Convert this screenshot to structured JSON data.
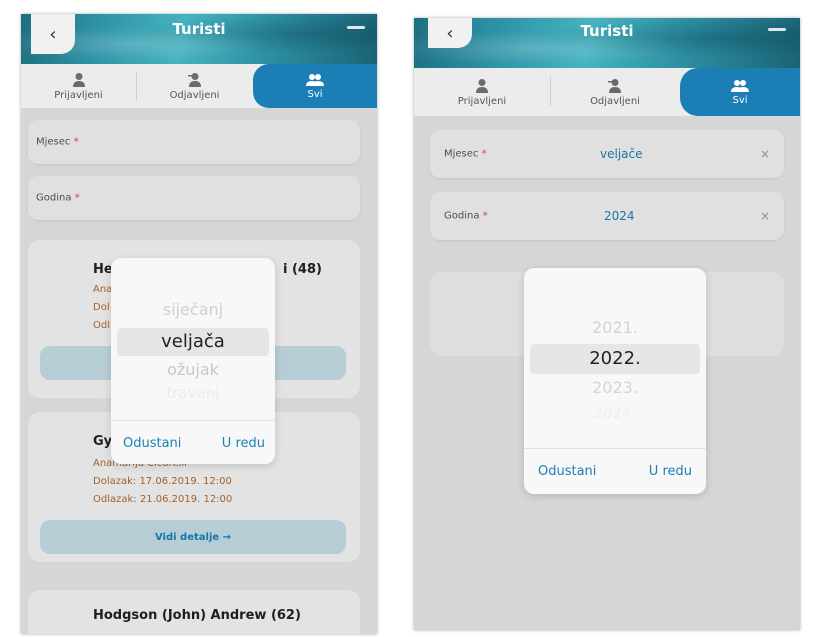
{
  "left": {
    "header": {
      "title": "Turisti",
      "back_icon": "chevron-left-icon"
    },
    "tabs": [
      {
        "label": "Prijavljeni",
        "icon": "user-icon"
      },
      {
        "label": "Odjavljeni",
        "icon": "user-minus-icon"
      },
      {
        "label": "Svi",
        "icon": "users-icon",
        "active": true
      }
    ],
    "fields": {
      "month": {
        "label": "Mjesec",
        "required": "*"
      },
      "year": {
        "label": "Godina",
        "required": "*"
      }
    },
    "cards": [
      {
        "name_start": "He",
        "name_end": "i (48)",
        "lines": [
          "Ana",
          "Dol",
          "Odl"
        ]
      },
      {
        "name_start": "Gy",
        "agent": "Anamarija Cicarelli",
        "arrival": "Dolazak: 17.06.2019. 12:00",
        "departure": "Odlazak: 21.06.2019. 12:00",
        "details": "Vidi detalje →"
      },
      {
        "name": "Hodgson (John) Andrew (62)"
      }
    ],
    "picker": {
      "items": [
        "siječanj",
        "veljača",
        "ožujak",
        "travanj"
      ],
      "selected_index": 1,
      "cancel": "Odustani",
      "ok": "U redu"
    }
  },
  "right": {
    "header": {
      "title": "Turisti"
    },
    "tabs": [
      {
        "label": "Prijavljeni",
        "icon": "user-icon"
      },
      {
        "label": "Odjavljeni",
        "icon": "user-minus-icon"
      },
      {
        "label": "Svi",
        "icon": "users-icon",
        "active": true
      }
    ],
    "fields": {
      "month": {
        "label": "Mjesec",
        "required": "*",
        "value": "veljače",
        "clear": "×"
      },
      "year": {
        "label": "Godina",
        "required": "*",
        "value": "2024",
        "clear": "×"
      }
    },
    "picker": {
      "items": [
        "2021.",
        "2022.",
        "2023.",
        "2024."
      ],
      "selected_index": 1,
      "cancel": "Odustani",
      "ok": "U redu"
    }
  },
  "colors": {
    "accent": "#1b7fb6",
    "required": "#e0463d",
    "background": "#e9e9e9"
  }
}
